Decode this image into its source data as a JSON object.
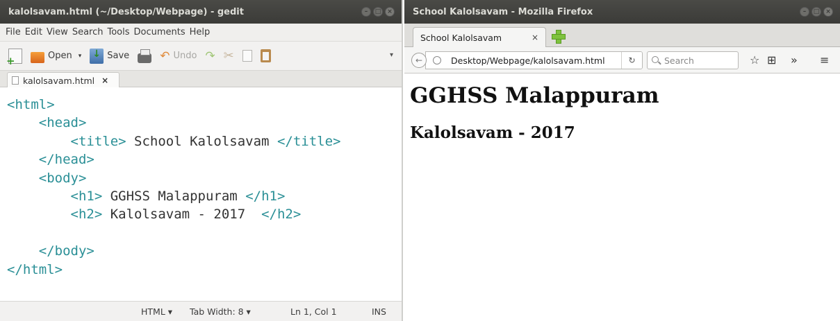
{
  "gedit": {
    "title": "kalolsavam.html (~/Desktop/Webpage) - gedit",
    "menu": [
      "File",
      "Edit",
      "View",
      "Search",
      "Tools",
      "Documents",
      "Help"
    ],
    "toolbar": {
      "open_label": "Open",
      "save_label": "Save",
      "undo_label": "Undo"
    },
    "tab_label": "kalolsavam.html",
    "code_lines": [
      "<html>",
      "    <head>",
      "        <title> School Kalolsavam </title>",
      "    </head>",
      "    <body>",
      "        <h1> GGHSS Malappuram </h1>",
      "        <h2> Kalolsavam - 2017  </h2>",
      "",
      "    </body>",
      "</html>"
    ],
    "status": {
      "language": "HTML ▾",
      "tab_width": "Tab Width: 8 ▾",
      "position": "Ln 1, Col 1",
      "mode": "INS"
    }
  },
  "firefox": {
    "title": "School Kalolsavam - Mozilla Firefox",
    "tab_label": "School Kalolsavam",
    "url": "Desktop/Webpage/kalolsavam.html",
    "search_placeholder": "Search",
    "page": {
      "h1": "GGHSS Malappuram",
      "h2": "Kalolsavam - 2017"
    }
  },
  "colors": {
    "tag": "#2a8f96",
    "titlebar": "#3d3d3a",
    "text": "#333333"
  }
}
